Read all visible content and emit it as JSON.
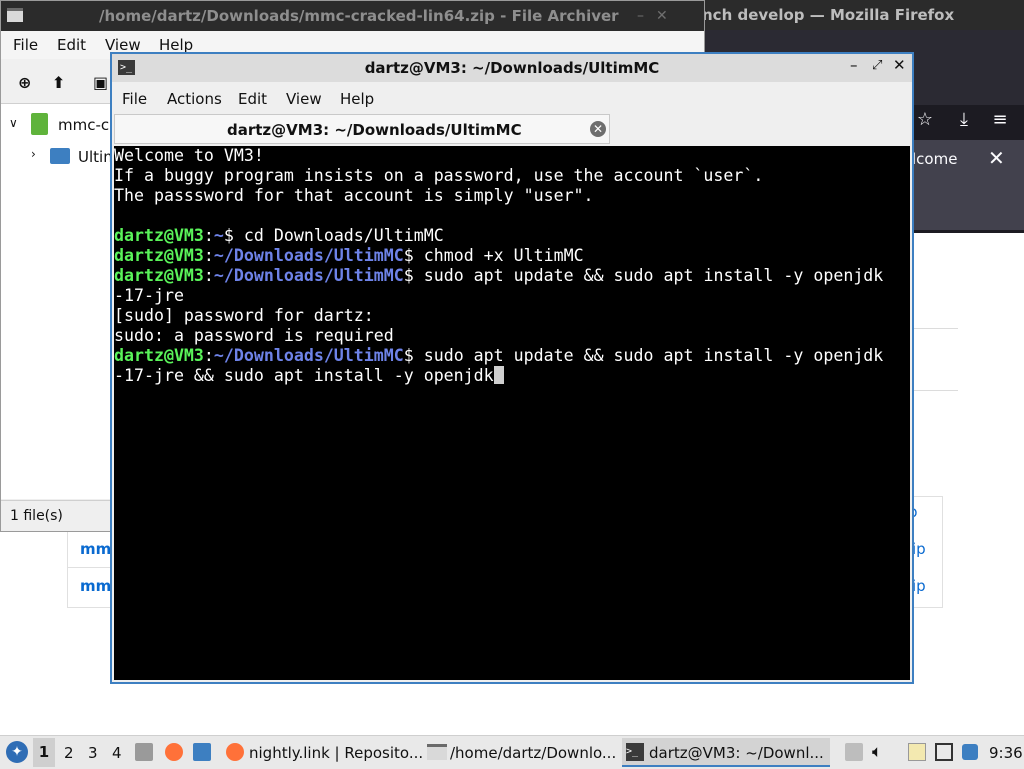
{
  "firefox": {
    "title": "nch develop — Mozilla Firefox",
    "notice_text": "lcome",
    "cells": [
      "p",
      "ip",
      "ip"
    ]
  },
  "archiver": {
    "title": "/home/dartz/Downloads/mmc-cracked-lin64.zip - File Archiver",
    "menu": [
      "File",
      "Edit",
      "View",
      "Help"
    ],
    "tree": [
      "mmc-cra",
      "Ultim"
    ],
    "status": "1 file(s)",
    "links": [
      "mm",
      "mm"
    ]
  },
  "terminal": {
    "title": "dartz@VM3: ~/Downloads/UltimMC",
    "menu": [
      "File",
      "Actions",
      "Edit",
      "View",
      "Help"
    ],
    "tab_label": "dartz@VM3: ~/Downloads/UltimMC",
    "lines": [
      {
        "text": "Welcome to VM3!"
      },
      {
        "text": "If a buggy program insists on a password, use the account `user`."
      },
      {
        "text": "The passsword for that account is simply \"user\"."
      },
      {
        "text": ""
      },
      {
        "user": "dartz@VM3",
        "path": "~",
        "cmd": "$ cd Downloads/UltimMC"
      },
      {
        "user": "dartz@VM3",
        "path": "~/Downloads/UltimMC",
        "cmd": "$ chmod +x UltimMC"
      },
      {
        "user": "dartz@VM3",
        "path": "~/Downloads/UltimMC",
        "cmd": "$ sudo apt update && sudo apt install -y openjdk"
      },
      {
        "text": "-17-jre"
      },
      {
        "text": "[sudo] password for dartz:"
      },
      {
        "text": "sudo: a password is required"
      },
      {
        "user": "dartz@VM3",
        "path": "~/Downloads/UltimMC",
        "cmd": "$ sudo apt update && sudo apt install -y openjdk"
      },
      {
        "text": "-17-jre && sudo apt install -y openjdk",
        "cursor": true
      }
    ]
  },
  "taskbar": {
    "workspaces": [
      "1",
      "2",
      "3",
      "4"
    ],
    "tasks": [
      "nightly.link | Reposito...",
      "/home/dartz/Downlo...",
      "dartz@VM3: ~/Downl..."
    ],
    "clock": "9:36"
  }
}
